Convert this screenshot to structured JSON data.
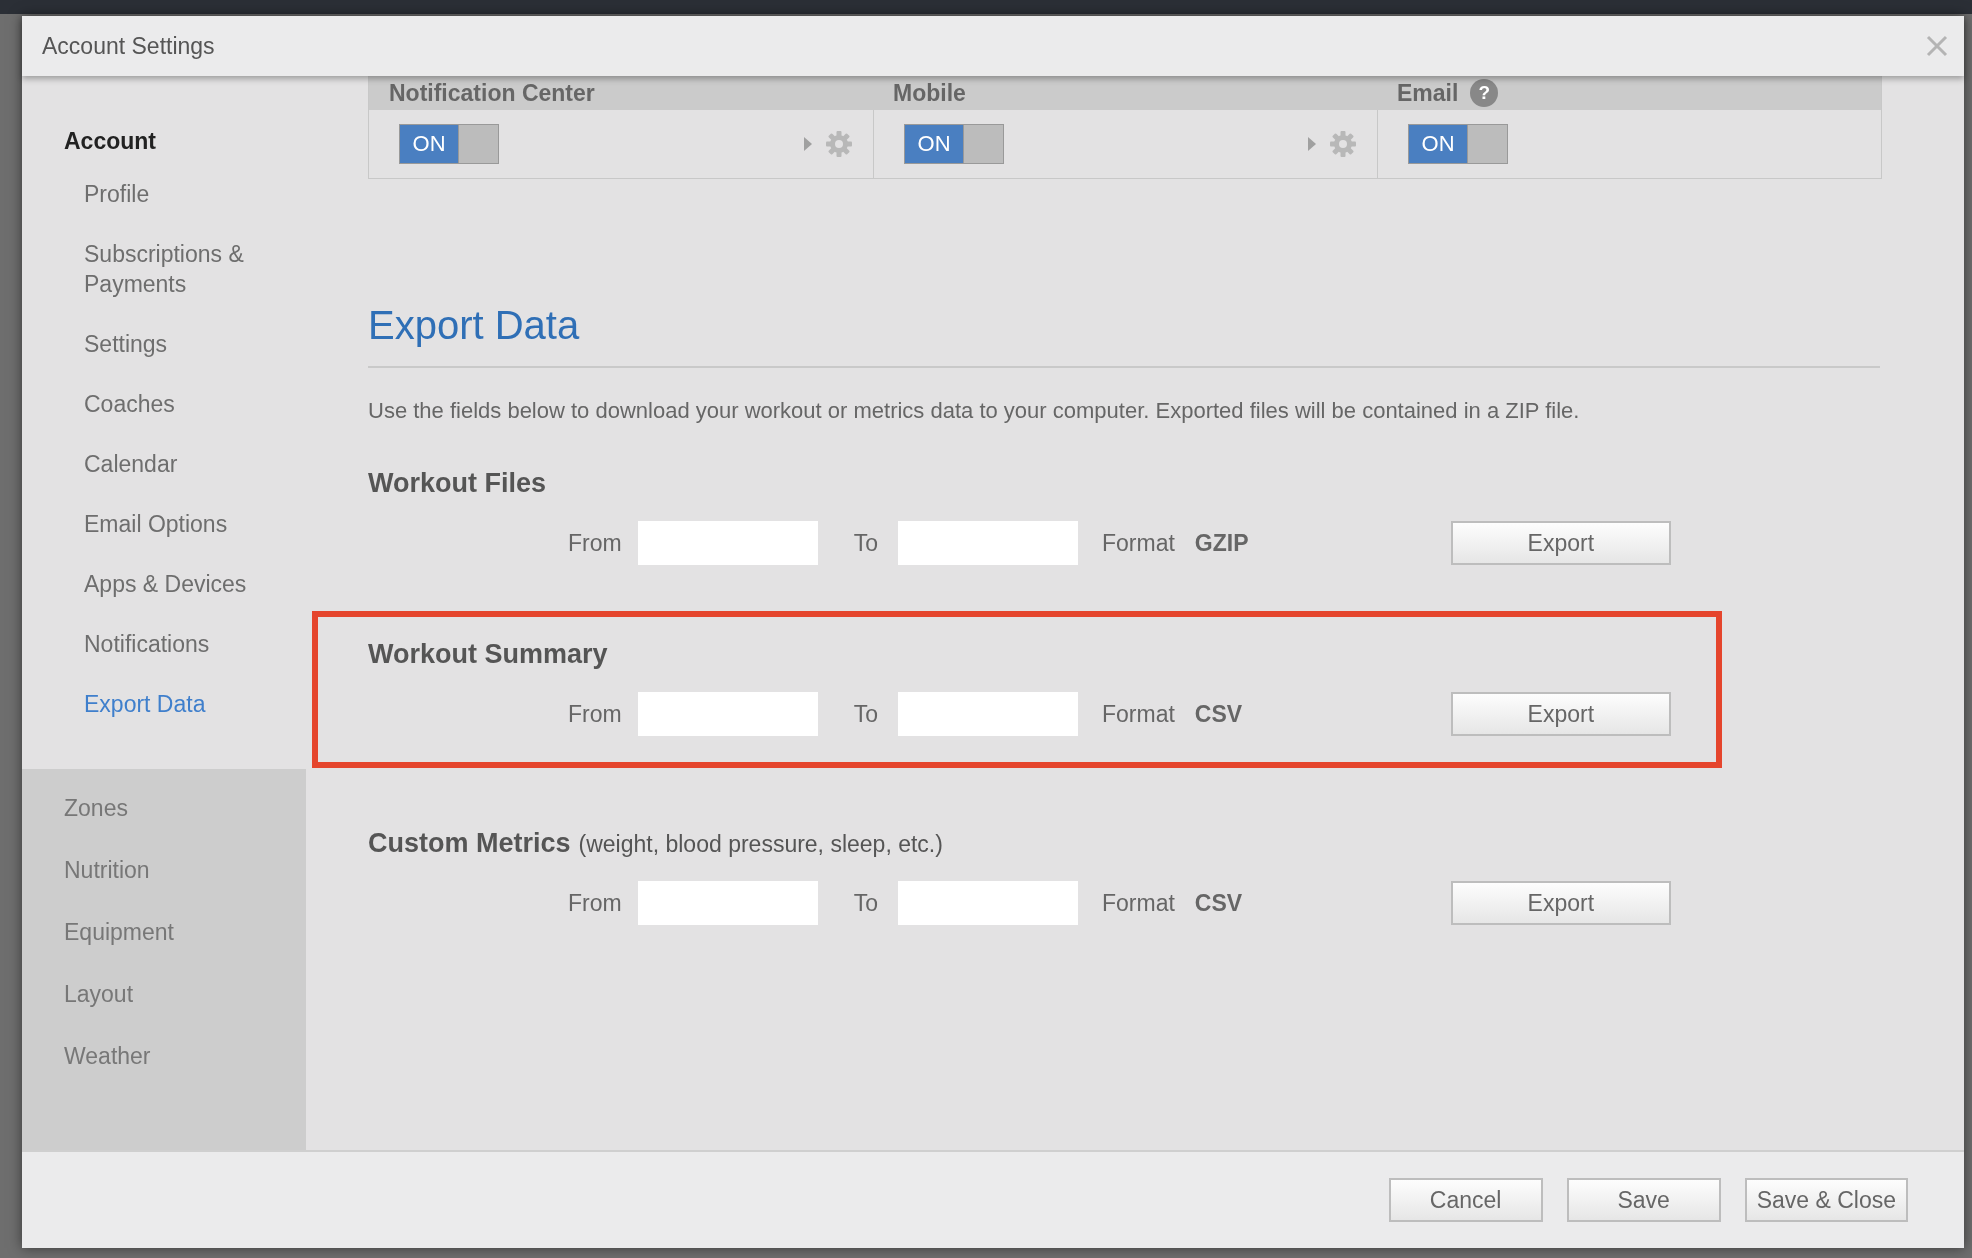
{
  "dialog": {
    "title": "Account Settings"
  },
  "sidebar": {
    "groups": [
      {
        "label": "Account",
        "expanded": true,
        "children": [
          {
            "label": "Profile",
            "selected": false
          },
          {
            "label": "Subscriptions & Payments",
            "selected": false
          },
          {
            "label": "Settings",
            "selected": false
          },
          {
            "label": "Coaches",
            "selected": false
          },
          {
            "label": "Calendar",
            "selected": false
          },
          {
            "label": "Email Options",
            "selected": false
          },
          {
            "label": "Apps & Devices",
            "selected": false
          },
          {
            "label": "Notifications",
            "selected": false
          },
          {
            "label": "Export Data",
            "selected": true
          }
        ]
      },
      {
        "label": "Zones",
        "expanded": false
      },
      {
        "label": "Nutrition",
        "expanded": false
      },
      {
        "label": "Equipment",
        "expanded": false
      },
      {
        "label": "Layout",
        "expanded": false
      },
      {
        "label": "Weather",
        "expanded": false
      }
    ]
  },
  "notifications": {
    "columns": [
      {
        "label": "Notification Center",
        "toggle_text": "ON",
        "on": true,
        "settings": true
      },
      {
        "label": "Mobile",
        "toggle_text": "ON",
        "on": true,
        "settings": true
      },
      {
        "label": "Email",
        "help_text": "?",
        "toggle_text": "ON",
        "on": true,
        "settings": false
      }
    ]
  },
  "export": {
    "title": "Export Data",
    "description": "Use the fields below to download your workout or metrics data to your computer. Exported files will be contained in a ZIP file.",
    "sections": [
      {
        "title": "Workout Files",
        "highlighted": false,
        "from_label": "From",
        "to_label": "To",
        "format_label": "Format",
        "format": "GZIP",
        "button": "Export"
      },
      {
        "title": "Workout Summary",
        "highlighted": true,
        "from_label": "From",
        "to_label": "To",
        "format_label": "Format",
        "format": "CSV",
        "button": "Export"
      },
      {
        "title": "Custom Metrics",
        "note": "(weight, blood pressure, sleep, etc.)",
        "highlighted": false,
        "from_label": "From",
        "to_label": "To",
        "format_label": "Format",
        "format": "CSV",
        "button": "Export"
      }
    ]
  },
  "footer": {
    "buttons": [
      "Cancel",
      "Save",
      "Save & Close"
    ]
  }
}
